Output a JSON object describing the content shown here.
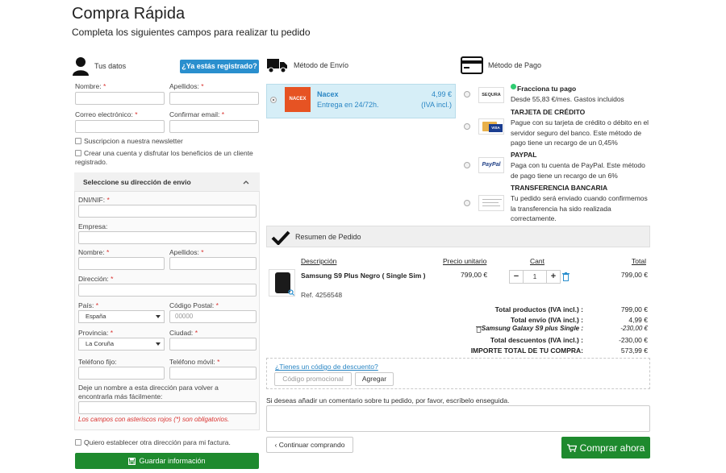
{
  "page": {
    "title": "Compra Rápida",
    "subtitle": "Completa los siguientes campos para realizar tu pedido"
  },
  "customer": {
    "section_title": "Tus datos",
    "registered_button": "¿Ya estás registrado?",
    "nombre_label": "Nombre:",
    "apellidos_label": "Apellidos:",
    "email_label": "Correo electrónico:",
    "confirm_email_label": "Confirmar email:",
    "required_mark": "*",
    "newsletter_label": "Suscripcion a nuestra newsletter",
    "create_account_label": "Crear una cuenta y disfrutar los beneficios de un cliente registrado."
  },
  "address": {
    "header": "Seleccione su dirección de envio",
    "dni_label": "DNI/NIF:",
    "empresa_label": "Empresa:",
    "nombre_label": "Nombre:",
    "apellidos_label": "Apellidos:",
    "direccion_label": "Dirección:",
    "pais_label": "País:",
    "pais_value": "España",
    "cp_label": "Código Postal:",
    "cp_placeholder": "00000",
    "provincia_label": "Provincia:",
    "provincia_value": "La Coruña",
    "ciudad_label": "Ciudad:",
    "telefono_label": "Teléfono fijo:",
    "movil_label": "Teléfono móvil:",
    "alias_label": "Deje un nombre a esta dirección para volver a encontrarla más fácilmente:",
    "required_note": "Los campos con asteriscos rojos (*) son obligatorios."
  },
  "invoice": {
    "other_address_label": "Quiero establecer otra dirección para mi factura."
  },
  "save_button": "Guardar información",
  "shipping": {
    "section_title": "Método de Envío",
    "carrier": "Nacex",
    "logo_text": "NACEX",
    "delivery": "Entrega en 24/72h.",
    "price": "4,99 €",
    "tax_note": "(IVA incl.)"
  },
  "payment": {
    "section_title": "Método de Pago",
    "methods": [
      {
        "title": "Fracciona tu pago",
        "desc": "Desde 55,83 €/mes. Gastos incluidos",
        "logo": "SEQURA"
      },
      {
        "title": "TARJETA DE CRÉDITO",
        "desc": "Pague con su tarjeta de crédito o débito en el servidor seguro del banco. Este método de pago tiene un recargo de un 0,45%",
        "logo": "VISA"
      },
      {
        "title": "PAYPAL",
        "desc": "Paga con tu cuenta de PayPal. Este método de pago tiene un recargo de un 6%",
        "logo": "PayPal"
      },
      {
        "title": "TRANSFERENCIA BANCARIA",
        "desc": "Tu pedido será enviado cuando confirmemos la transferencia ha sido realizada correctamente.",
        "logo": ""
      }
    ]
  },
  "summary": {
    "section_title": "Resumen de Pedido",
    "columns": {
      "desc": "Descripción",
      "unit": "Precio unitario",
      "qty": "Cant",
      "total": "Total"
    },
    "item": {
      "name": "Samsung S9 Plus Negro ( Single Sim )",
      "ref": "Ref. 4256548",
      "unit_price": "799,00 €",
      "qty": "1",
      "total": "799,00 €"
    },
    "totals": [
      {
        "label": "Total productos  (IVA incl.) :",
        "value": "799,00 €"
      },
      {
        "label": "Total envío  (IVA incl.) :",
        "value": "4,99 €"
      },
      {
        "label": "Samsung Galaxy S9 plus Single :",
        "value": "-230,00 €"
      },
      {
        "label": "Total descuentos  (IVA incl.) :",
        "value": "-230,00 €"
      },
      {
        "label": "IMPORTE TOTAL DE TU COMPRA:",
        "value": "573,99 €"
      }
    ]
  },
  "promo": {
    "link": "¿Tienes un código de descuento?",
    "placeholder": "Código promocional",
    "apply_button": "Agregar"
  },
  "comment": {
    "label": "Si deseas añadir un comentario sobre tu pedido, por favor, escríbelo enseguida."
  },
  "continue_button": "Continuar comprando",
  "buy_button": "Comprar ahora",
  "colors": {
    "green": "#1e8a2e",
    "blue": "#2a8fce",
    "ship_bg": "#d6eef7",
    "required": "#d9322f"
  }
}
